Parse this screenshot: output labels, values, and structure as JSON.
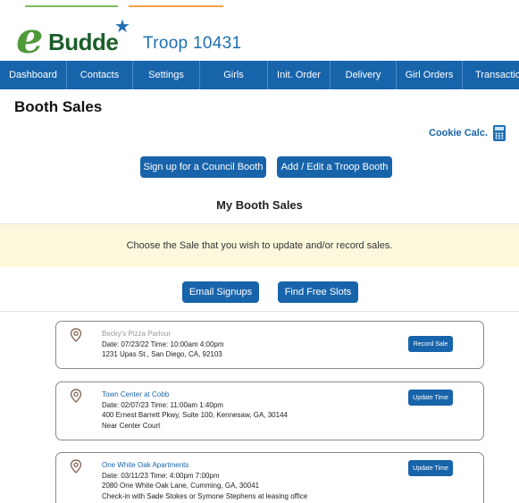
{
  "header": {
    "logo_letter": "e",
    "logo_word": "Budde",
    "troop_title": "Troop 10431"
  },
  "nav": {
    "items": [
      {
        "label": "Dashboard"
      },
      {
        "label": "Contacts"
      },
      {
        "label": "Settings"
      },
      {
        "label": "Girls"
      },
      {
        "label": "Init. Order"
      },
      {
        "label": "Delivery"
      },
      {
        "label": "Girl Orders"
      },
      {
        "label": "Transactions"
      }
    ]
  },
  "page": {
    "title": "Booth Sales",
    "cookie_calc_label": "Cookie Calc.",
    "signup_council_label": "Sign up for a Council Booth",
    "add_troop_label": "Add / Edit a Troop Booth",
    "section_title": "My Booth Sales",
    "notice": "Choose the Sale that you wish to update and/or record sales.",
    "email_signups_label": "Email Signups",
    "find_slots_label": "Find Free Slots"
  },
  "booths": [
    {
      "name": "Becky's Pizza Parlour",
      "date_line": "Date: 07/23/22  Time: 10:00am 4:00pm",
      "address": "1231 Upas St., San Diego, CA, 92103",
      "note": "",
      "action": "Record Sale"
    },
    {
      "name": "Town Center at Cobb",
      "date_line": "Date: 02/07/23  Time: 11:00am 1:40pm",
      "address": "400 Ernest Barrett Pkwy, Suite 100, Kennesaw, GA, 30144",
      "note": "Near Center Court",
      "action": "Update Time"
    },
    {
      "name": "One White Oak Apartments",
      "date_line": "Date: 03/11/23  Time: 4:00pm 7:00pm",
      "address": "2080 One White Oak Lane, Cumming, GA, 30041",
      "note": "Check-in with Sade Stokes or Symone Stephens at leasing office",
      "action": "Update Time"
    }
  ],
  "colors": {
    "nav_blue": "#1864ab",
    "brand_green": "#4f9a3a",
    "notice_bg": "#fcf8dc",
    "pin_brown": "#8a6a5a"
  }
}
